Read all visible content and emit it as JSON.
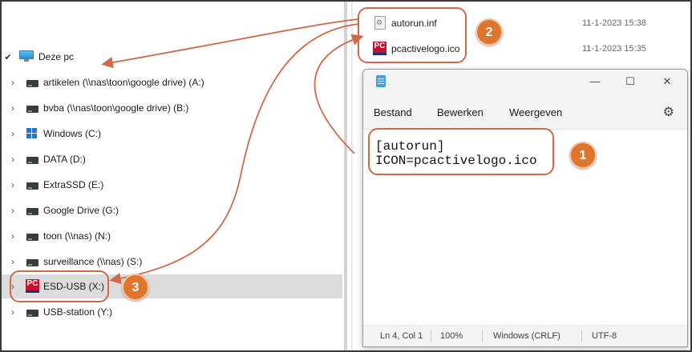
{
  "tree": {
    "root": {
      "label": "Deze pc",
      "icon": "computer-icon"
    },
    "items": [
      {
        "label": "artikelen (\\\\nas\\toon\\google drive) (A:)",
        "icon": "network-drive-icon"
      },
      {
        "label": "bvba (\\\\nas\\toon\\google drive) (B:)",
        "icon": "network-drive-icon"
      },
      {
        "label": "Windows  (C:)",
        "icon": "windows-drive-icon"
      },
      {
        "label": "DATA (D:)",
        "icon": "drive-icon"
      },
      {
        "label": "ExtraSSD (E:)",
        "icon": "drive-icon"
      },
      {
        "label": "Google Drive (G:)",
        "icon": "drive-icon"
      },
      {
        "label": "toon (\\\\nas) (N:)",
        "icon": "network-drive-icon"
      },
      {
        "label": "surveillance (\\\\nas) (S:)",
        "icon": "network-drive-icon"
      },
      {
        "label": "ESD-USB (X:)",
        "icon": "pcactive-logo-icon",
        "selected": true
      },
      {
        "label": "USB-station (Y:)",
        "icon": "drive-icon"
      }
    ]
  },
  "files": [
    {
      "name": "autorun.inf",
      "date": "11-1-2023 15:38",
      "icon": "settings-file-icon"
    },
    {
      "name": "pcactivelogo.ico",
      "date": "11-1-2023 15:35",
      "icon": "pcactive-logo-icon"
    }
  ],
  "logo_text": "PC",
  "notepad": {
    "menu": [
      "Bestand",
      "Bewerken",
      "Weergeven"
    ],
    "window_controls": {
      "minimize": "—",
      "maximize": "☐",
      "close": "✕"
    },
    "content": [
      "[autorun]",
      "ICON=pcactivelogo.ico"
    ],
    "status": {
      "position": "Ln 4, Col 1",
      "zoom": "100%",
      "line_ending": "Windows (CRLF)",
      "encoding": "UTF-8"
    }
  },
  "annotations": {
    "badge1": "1",
    "badge2": "2",
    "badge3": "3",
    "accent_color": "#e0762e",
    "outline_color": "#d2684a"
  },
  "colors": {
    "selection": "#dcdcdc",
    "logo_red": "#c8102e",
    "logo_blue": "#1b2f7a"
  }
}
